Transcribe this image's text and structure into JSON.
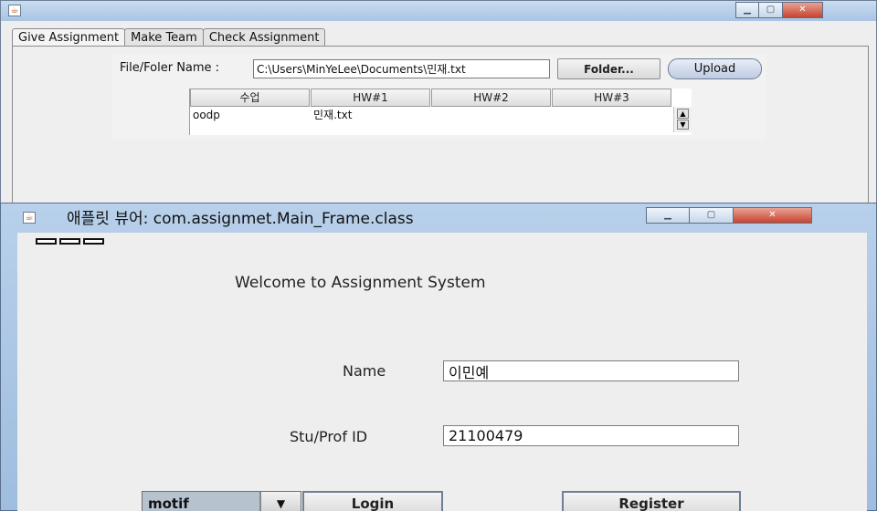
{
  "back_window": {
    "tabs": [
      "Give Assignment",
      "Make Team",
      "Check Assignment"
    ],
    "file_label": "File/Foler Name :",
    "file_path": "C:\\Users\\MinYeLee\\Documents\\민재.txt",
    "folder_button": "Folder...",
    "upload_button": "Upload",
    "table": {
      "headers": [
        "수업",
        "HW#1",
        "HW#2",
        "HW#3"
      ],
      "rows": [
        [
          "oodp",
          "민재.txt",
          "",
          ""
        ]
      ]
    },
    "window_buttons": [
      "minimize",
      "maximize",
      "close"
    ]
  },
  "front_window": {
    "title": "애플릿 뷰어: com.assignmet.Main_Frame.class",
    "welcome": "Welcome to Assignment System",
    "name_label": "Name",
    "name_value": "이민예",
    "id_label": "Stu/Prof ID",
    "id_value": "21100479",
    "look_and_feel_value": "motif",
    "login_button": "Login",
    "register_button": "Register",
    "window_buttons": [
      "minimize",
      "maximize",
      "close"
    ]
  },
  "colors": {
    "title_bar": "#b8d0ea",
    "close_button": "#c8442e",
    "panel_bg": "#eeeeee"
  },
  "icons": [
    "java-applet-icon",
    "minimize-icon",
    "maximize-icon",
    "close-icon",
    "scroll-up-icon",
    "scroll-down-icon",
    "dropdown-arrow-icon"
  ]
}
